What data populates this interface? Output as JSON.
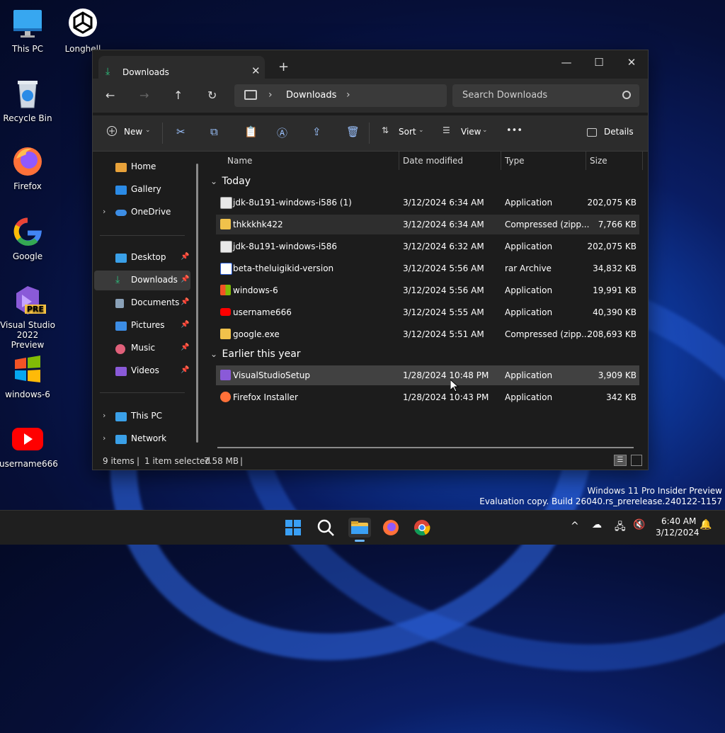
{
  "desktop": {
    "icons": [
      {
        "label": "This PC",
        "icon": "monitor-icon"
      },
      {
        "label": "Longhell",
        "icon": "unity-icon"
      },
      {
        "label": "Recycle Bin",
        "icon": "recycle-bin-icon"
      },
      {
        "label": "Firefox",
        "icon": "firefox-icon"
      },
      {
        "label": "Google",
        "icon": "google-icon"
      },
      {
        "label": "Visual Studio 2022 Preview",
        "icon": "visual-studio-icon",
        "badge": "PRE"
      },
      {
        "label": "windows-6",
        "icon": "windows-logo-icon"
      },
      {
        "label": "username666",
        "icon": "youtube-icon"
      }
    ],
    "watermark": {
      "line1": "Windows 11 Pro Insider Preview",
      "line2": "Evaluation copy. Build 26040.rs_prerelease.240122-1157"
    }
  },
  "explorer": {
    "tab_title": "Downloads",
    "tab_close": "✕",
    "new_tab": "+",
    "window_buttons": {
      "minimize": "—",
      "maximize": "☐",
      "close": "✕"
    },
    "nav": {
      "back": "←",
      "forward": "→",
      "up": "↑",
      "refresh": "↻"
    },
    "address": {
      "sep1": "›",
      "location": "Downloads",
      "sep2": "›"
    },
    "search_placeholder": "Search Downloads",
    "toolbar": {
      "new_label": "New",
      "sort_label": "Sort",
      "view_label": "View",
      "more_label": "•••",
      "details_label": "Details"
    },
    "sidebar": {
      "top": [
        {
          "label": "Home",
          "icon": "home-icon",
          "color": "#e8a23a"
        },
        {
          "label": "Gallery",
          "icon": "gallery-icon",
          "color": "#2b8be6"
        },
        {
          "label": "OneDrive",
          "icon": "onedrive-icon",
          "color": "#3c8de5",
          "expand": "›"
        }
      ],
      "quick": [
        {
          "label": "Desktop",
          "icon": "desktop-icon",
          "color": "#3aa0e8",
          "pin": "📌"
        },
        {
          "label": "Downloads",
          "icon": "download-icon",
          "color": "#2ec27e",
          "pin": "📌",
          "selected": true
        },
        {
          "label": "Documents",
          "icon": "documents-icon",
          "color": "#8aa1b8",
          "pin": "📌"
        },
        {
          "label": "Pictures",
          "icon": "pictures-icon",
          "color": "#3c8de5",
          "pin": "📌"
        },
        {
          "label": "Music",
          "icon": "music-icon",
          "color": "#e0607a",
          "pin": "📌"
        },
        {
          "label": "Videos",
          "icon": "videos-icon",
          "color": "#8a5ad8",
          "pin": "📌"
        }
      ],
      "bottom": [
        {
          "label": "This PC",
          "icon": "this-pc-icon",
          "color": "#3aa0e8",
          "expand": "›"
        },
        {
          "label": "Network",
          "icon": "network-icon",
          "color": "#3aa0e8",
          "expand": "›"
        }
      ]
    },
    "columns": {
      "name": "Name",
      "date": "Date modified",
      "type": "Type",
      "size": "Size"
    },
    "groups": [
      {
        "label": "Today",
        "chevron": "⌄",
        "files": [
          {
            "name": "jdk-8u191-windows-i586 (1)",
            "date": "3/12/2024 6:34 AM",
            "type": "Application",
            "size": "202,075 KB",
            "icon": "java-installer-icon"
          },
          {
            "name": "thkkkhk422",
            "date": "3/12/2024 6:34 AM",
            "type": "Compressed (zipp...",
            "size": "7,766 KB",
            "icon": "zip-folder-icon"
          },
          {
            "name": "jdk-8u191-windows-i586",
            "date": "3/12/2024 6:32 AM",
            "type": "Application",
            "size": "202,075 KB",
            "icon": "java-installer-icon"
          },
          {
            "name": "beta-theluigikid-version",
            "date": "3/12/2024 5:56 AM",
            "type": "rar Archive",
            "size": "34,832 KB",
            "icon": "rar-archive-icon"
          },
          {
            "name": "windows-6",
            "date": "3/12/2024 5:56 AM",
            "type": "Application",
            "size": "19,991 KB",
            "icon": "windows-logo-icon"
          },
          {
            "name": "username666",
            "date": "3/12/2024 5:55 AM",
            "type": "Application",
            "size": "40,390 KB",
            "icon": "youtube-icon"
          },
          {
            "name": "google.exe",
            "date": "3/12/2024 5:51 AM",
            "type": "Compressed (zipp...",
            "size": "208,693 KB",
            "icon": "zip-folder-icon"
          }
        ]
      },
      {
        "label": "Earlier this year",
        "chevron": "⌄",
        "files": [
          {
            "name": "VisualStudioSetup",
            "date": "1/28/2024 10:48 PM",
            "type": "Application",
            "size": "3,909 KB",
            "icon": "visual-studio-icon"
          },
          {
            "name": "Firefox Installer",
            "date": "1/28/2024 10:43 PM",
            "type": "Application",
            "size": "342 KB",
            "icon": "firefox-icon"
          }
        ]
      }
    ],
    "status": {
      "items": "9 items",
      "sep": "|",
      "selected": "1 item selected",
      "size": "7.58 MB"
    }
  },
  "taskbar": {
    "time": "6:40 AM",
    "date": "3/12/2024",
    "apps": [
      "start-icon",
      "search-icon",
      "file-explorer-icon",
      "firefox-icon",
      "chrome-icon"
    ],
    "tray_chevron": "^"
  }
}
